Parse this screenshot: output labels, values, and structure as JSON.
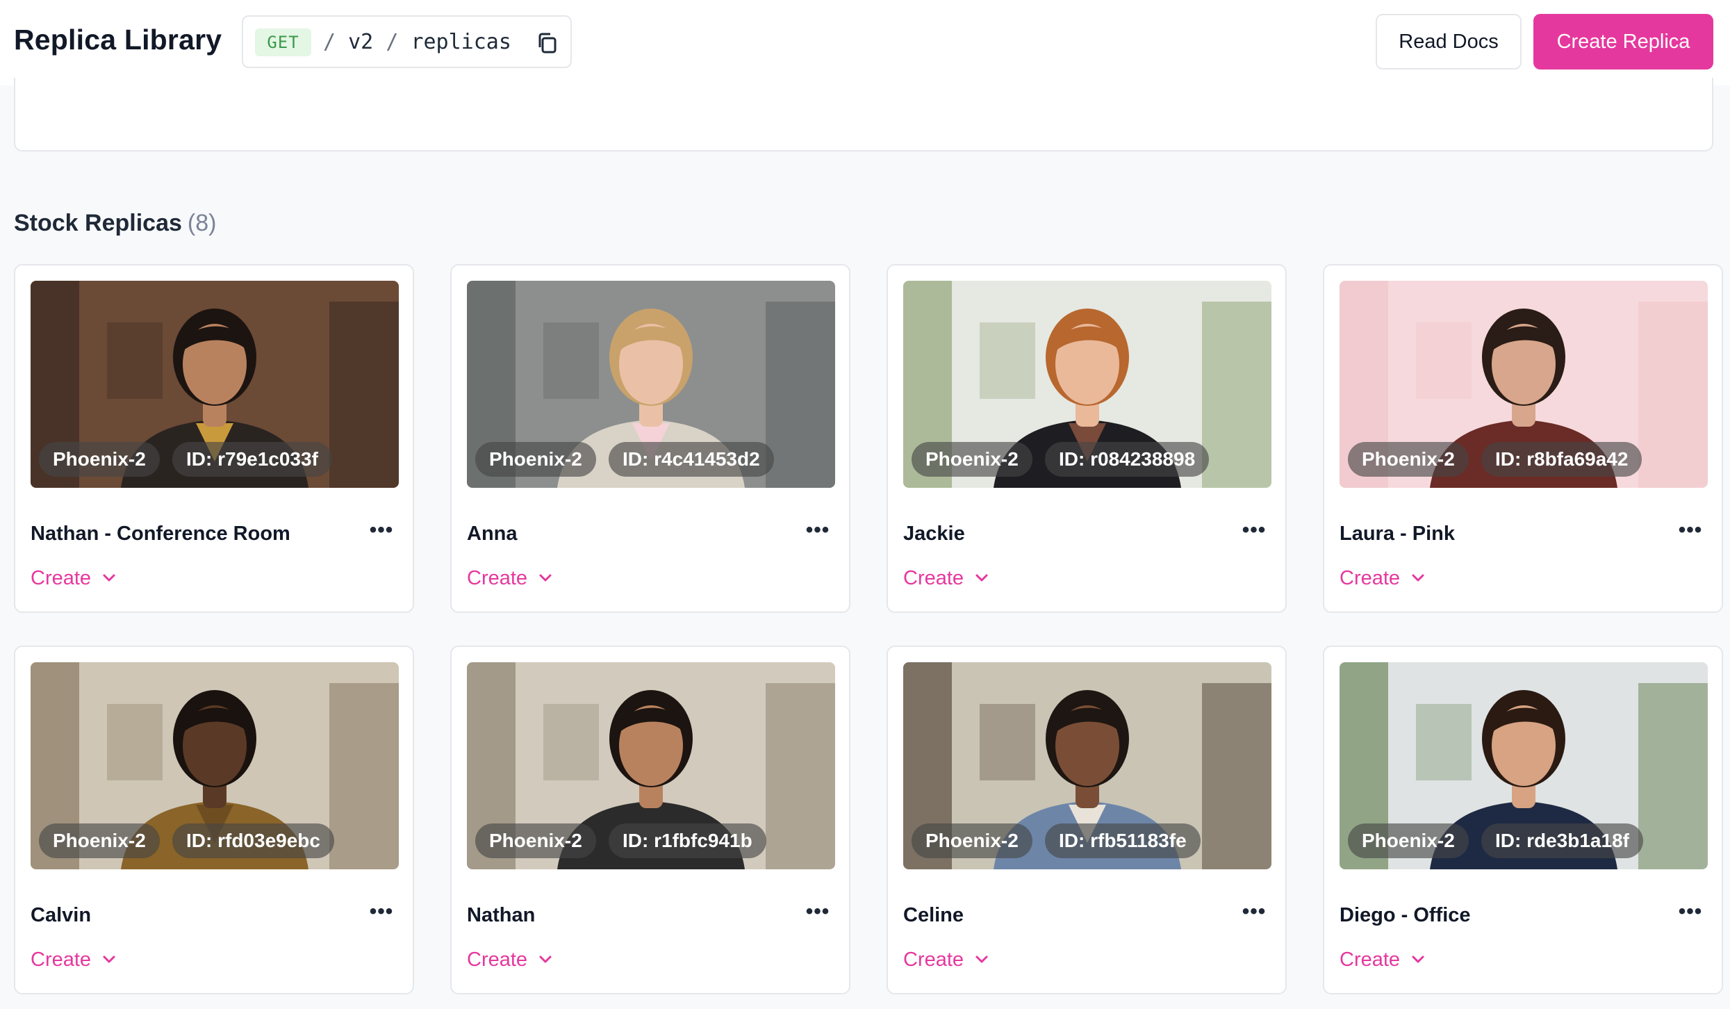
{
  "header": {
    "title": "Replica Library",
    "endpoint": {
      "method": "GET",
      "path_parts": [
        "v2",
        "replicas"
      ],
      "separator": "/",
      "copy_icon": "copy-icon"
    },
    "read_docs_label": "Read Docs",
    "create_replica_label": "Create Replica"
  },
  "colors": {
    "accent": "#e5389e",
    "method_badge_bg": "#e4f6e4",
    "method_badge_text": "#3a9a4a",
    "page_bg": "#f8f9fb"
  },
  "section": {
    "title": "Stock Replicas",
    "count": "(8)"
  },
  "replicas": [
    {
      "name": "Nathan - Conference Room",
      "model": "Phoenix-2",
      "id": "ID: r79e1c033f",
      "create_label": "Create",
      "more_icon": "more-horizontal-icon",
      "thumb": {
        "bg": "#6b4a36",
        "bg2": "#3b2a22",
        "skin": "#b9825f",
        "hair": "#1c1410",
        "shirt": "#2a2420",
        "inner": "#c99a3c"
      }
    },
    {
      "name": "Anna",
      "model": "Phoenix-2",
      "id": "ID: r4c41453d2",
      "create_label": "Create",
      "more_icon": "more-horizontal-icon",
      "thumb": {
        "bg": "#8c8f8e",
        "bg2": "#5e6262",
        "skin": "#eac1a6",
        "hair": "#c9a26b",
        "shirt": "#d9d3c7",
        "inner": "#f4d2d8"
      }
    },
    {
      "name": "Jackie",
      "model": "Phoenix-2",
      "id": "ID: r084238898",
      "create_label": "Create",
      "more_icon": "more-horizontal-icon",
      "thumb": {
        "bg": "#e6e8e2",
        "bg2": "#93a77a",
        "skin": "#e9b99a",
        "hair": "#b8672f",
        "shirt": "#1e1e22",
        "inner": "#7a4a3a"
      }
    },
    {
      "name": "Laura - Pink",
      "model": "Phoenix-2",
      "id": "ID: r8bfa69a42",
      "create_label": "Create",
      "more_icon": "more-horizontal-icon",
      "thumb": {
        "bg": "#f6d9dc",
        "bg2": "#f0c4c9",
        "skin": "#d8a68c",
        "hair": "#2a1c16",
        "shirt": "#6b2b26",
        "inner": "#6b2b26"
      }
    },
    {
      "name": "Calvin",
      "model": "Phoenix-2",
      "id": "ID: rfd03e9ebc",
      "create_label": "Create",
      "more_icon": "more-horizontal-icon",
      "thumb": {
        "bg": "#cfc6b6",
        "bg2": "#8a7a62",
        "skin": "#5a3a26",
        "hair": "#1a120e",
        "shirt": "#8a6428",
        "inner": "#6e4e20"
      }
    },
    {
      "name": "Nathan",
      "model": "Phoenix-2",
      "id": "ID: r1fbfc941b",
      "create_label": "Create",
      "more_icon": "more-horizontal-icon",
      "thumb": {
        "bg": "#d2cbbd",
        "bg2": "#8e8573",
        "skin": "#b9825f",
        "hair": "#1c1410",
        "shirt": "#2b2b2b",
        "inner": "#2b2b2b"
      }
    },
    {
      "name": "Celine",
      "model": "Phoenix-2",
      "id": "ID: rfb51183fe",
      "create_label": "Create",
      "more_icon": "more-horizontal-icon",
      "thumb": {
        "bg": "#c9c4b4",
        "bg2": "#5b4e40",
        "skin": "#7a4e36",
        "hair": "#1e1612",
        "shirt": "#6d86a8",
        "inner": "#e8e2d8"
      }
    },
    {
      "name": "Diego - Office",
      "model": "Phoenix-2",
      "id": "ID: rde3b1a18f",
      "create_label": "Create",
      "more_icon": "more-horizontal-icon",
      "thumb": {
        "bg": "#dfe3e3",
        "bg2": "#6f8a5e",
        "skin": "#d7a383",
        "hair": "#2a1a12",
        "shirt": "#1e2a44",
        "inner": "#1e2a44"
      }
    }
  ]
}
